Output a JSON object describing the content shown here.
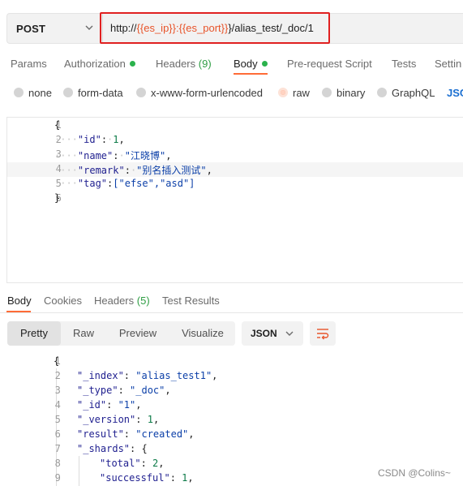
{
  "request": {
    "method": "POST",
    "url_prefix": "http://",
    "url_var1": "{{es_ip}}",
    "url_colon": ":",
    "url_var2": "{{es_port}}",
    "url_suffix": "}/alias_test/_doc/1"
  },
  "tabs": [
    {
      "label": "Params"
    },
    {
      "label": "Authorization"
    },
    {
      "label": "Headers",
      "count": "(9)"
    },
    {
      "label": "Body"
    },
    {
      "label": "Pre-request Script"
    },
    {
      "label": "Tests"
    },
    {
      "label": "Settin"
    }
  ],
  "body_types": [
    {
      "label": "none"
    },
    {
      "label": "form-data"
    },
    {
      "label": "x-www-form-urlencoded"
    },
    {
      "label": "raw"
    },
    {
      "label": "binary"
    },
    {
      "label": "GraphQL"
    },
    {
      "label": "JSC"
    }
  ],
  "request_body": {
    "line_numbers": [
      "1",
      "2",
      "3",
      "4",
      "5",
      "6"
    ],
    "l1": "{",
    "l2_key": "\"id\"",
    "l2_val": "1",
    "l3_key": "\"name\"",
    "l3_val": "\"江晓博\"",
    "l4_key": "\"remark\"",
    "l4_val": "\"别名插入测试\"",
    "l5_key": "\"tag\"",
    "l5_val": "[\"efse\",\"asd\"]",
    "l6": "}"
  },
  "response_tabs": [
    {
      "label": "Body"
    },
    {
      "label": "Cookies"
    },
    {
      "label": "Headers",
      "count": "(5)"
    },
    {
      "label": "Test Results"
    }
  ],
  "view_modes": {
    "pretty": "Pretty",
    "raw": "Raw",
    "preview": "Preview",
    "visualize": "Visualize"
  },
  "format": "JSON",
  "response_body": {
    "line_numbers": [
      "1",
      "2",
      "3",
      "4",
      "5",
      "6",
      "7",
      "8",
      "9"
    ],
    "l1": "{",
    "l2_key": "\"_index\"",
    "l2_val": "\"alias_test1\"",
    "l3_key": "\"_type\"",
    "l3_val": "\"_doc\"",
    "l4_key": "\"_id\"",
    "l4_val": "\"1\"",
    "l5_key": "\"_version\"",
    "l5_val": "1",
    "l6_key": "\"result\"",
    "l6_val": "\"created\"",
    "l7_key": "\"_shards\"",
    "l7_val": "{",
    "l8_key": "\"total\"",
    "l8_val": "2",
    "l9_key": "\"successful\"",
    "l9_val": "1"
  },
  "watermark": "CSDN @Colins~",
  "colors": {
    "accent": "#ff6c37",
    "url_highlight": "#e02020",
    "variable": "#e8542a",
    "status_dot": "#2bb24c"
  }
}
